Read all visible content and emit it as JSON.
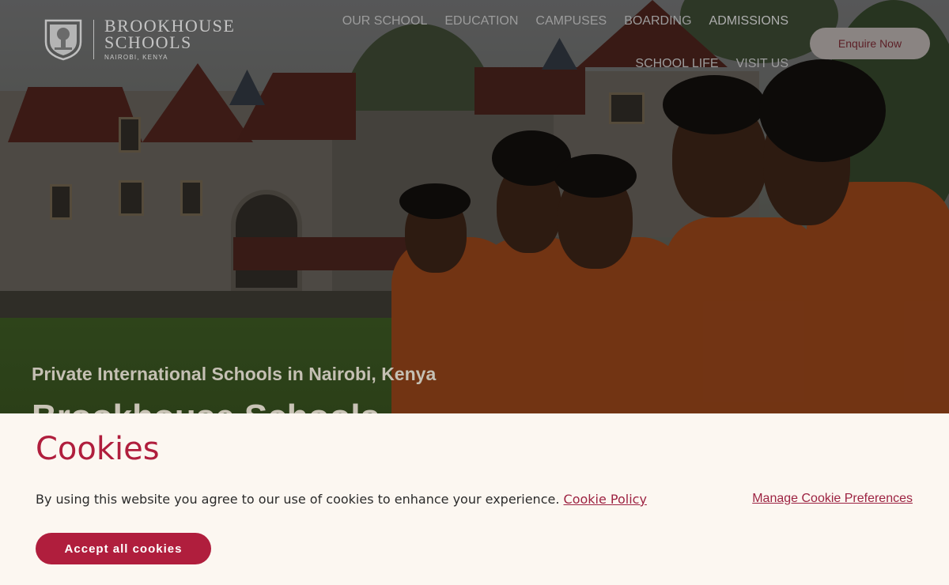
{
  "brand": {
    "name_line1": "Brookhouse",
    "name_line2": "Schools",
    "location": "Nairobi, Kenya",
    "logo_icon": "crest-shield-icon"
  },
  "nav": {
    "items": [
      {
        "label": "Our School"
      },
      {
        "label": "Education"
      },
      {
        "label": "Campuses"
      },
      {
        "label": "Boarding"
      },
      {
        "label": "Admissions"
      },
      {
        "label": "School Life"
      },
      {
        "label": "Visit Us"
      }
    ],
    "cta_label": "Enquire Now"
  },
  "hero": {
    "subtitle": "Private International Schools in Nairobi, Kenya",
    "title": "Brookhouse Schools",
    "image_description": "students in orange school blazers in front of castle-style school building"
  },
  "cookie_banner": {
    "title": "Cookies",
    "message": "By using this website you agree to our use of cookies to enhance your experience.",
    "policy_link": "Cookie Policy",
    "manage_link": "Manage Cookie Preferences",
    "accept_label": "Accept all cookies"
  },
  "colors": {
    "brand_red": "#b01e3d",
    "banner_bg": "#fcf7f1",
    "blazer_orange": "#b85420"
  }
}
